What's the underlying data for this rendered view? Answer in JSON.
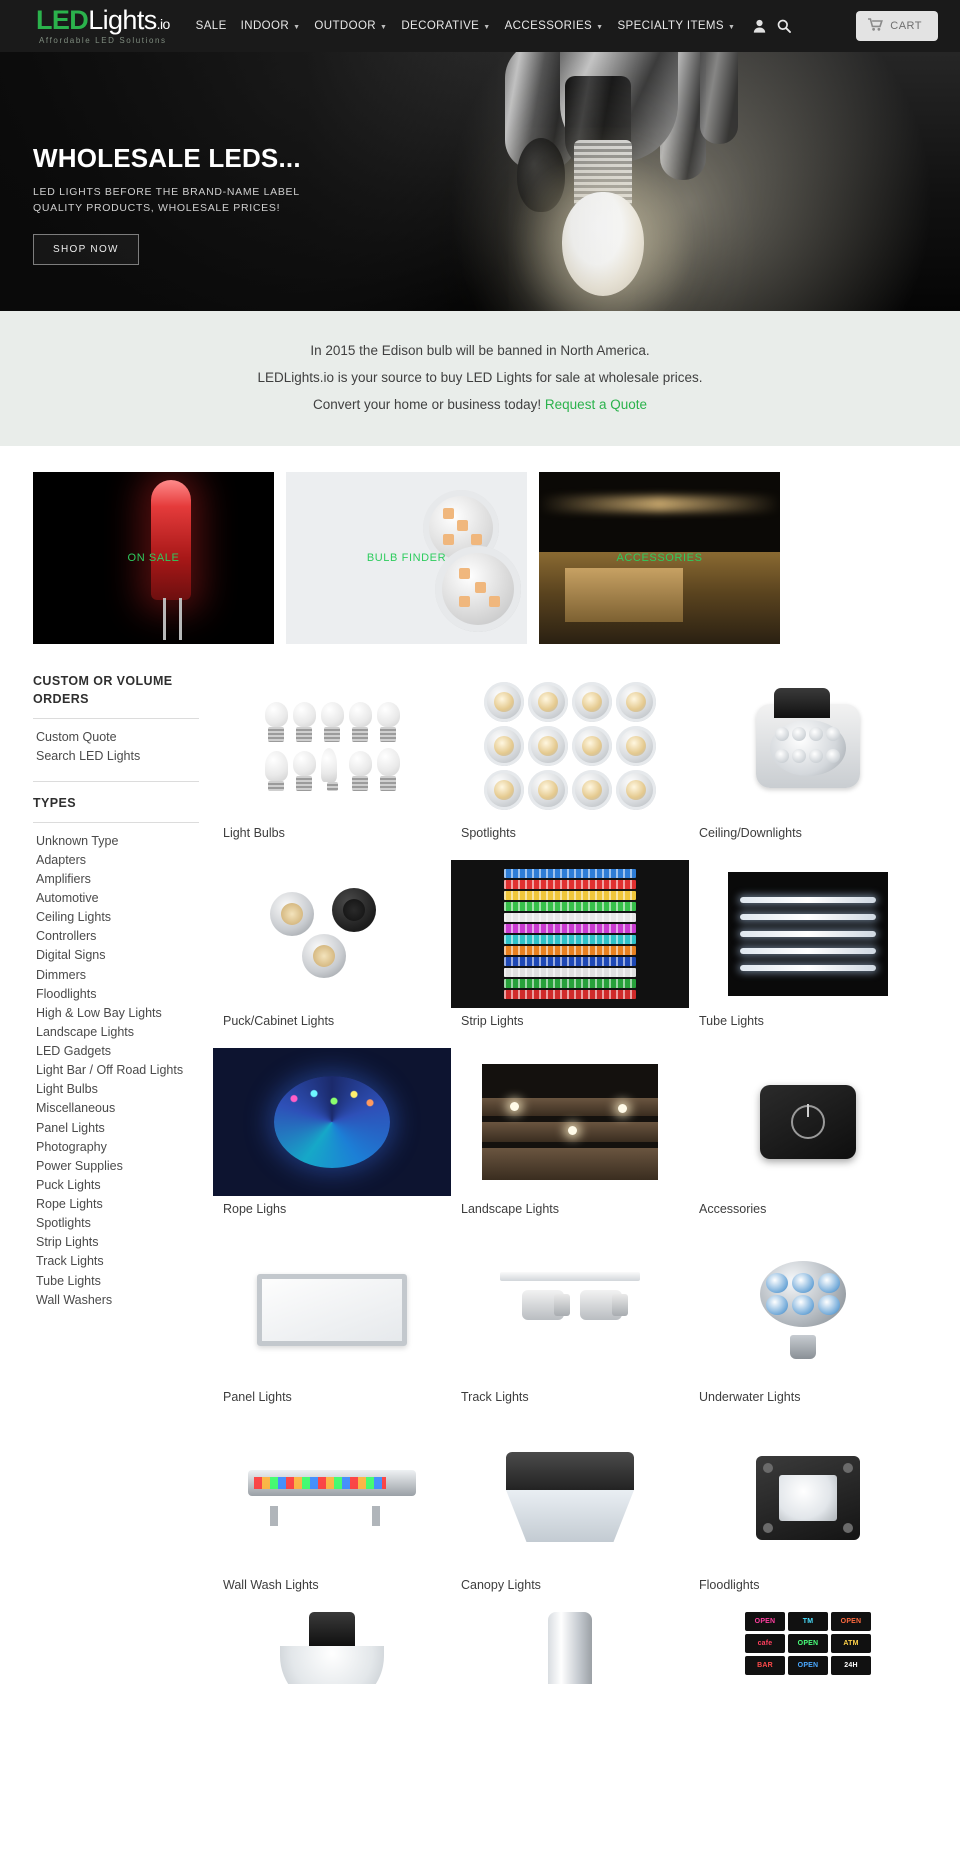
{
  "header": {
    "logo": {
      "led": "LED",
      "lights": "Lights",
      "io": ".io",
      "tagline": "Affordable LED Solutions"
    },
    "nav": [
      {
        "label": "SALE",
        "has_caret": false
      },
      {
        "label": "INDOOR",
        "has_caret": true
      },
      {
        "label": "OUTDOOR",
        "has_caret": true
      },
      {
        "label": "DECORATIVE",
        "has_caret": true
      },
      {
        "label": "ACCESSORIES",
        "has_caret": true
      },
      {
        "label": "SPECIALTY ITEMS",
        "has_caret": true
      }
    ],
    "account_icon": "user-icon",
    "search_icon": "search-icon",
    "cart_label": "CART",
    "cart_icon": "cart-icon"
  },
  "hero": {
    "title": "WHOLESALE LEDS...",
    "subtitle_line1": "LED LIGHTS BEFORE THE BRAND-NAME LABEL",
    "subtitle_line2": "QUALITY PRODUCTS, WHOLESALE PRICES!",
    "button_label": "SHOP NOW"
  },
  "infobar": {
    "line1": "In 2015 the Edison bulb will be banned in North America.",
    "line2": "LEDLights.io is your source to buy LED Lights for sale at wholesale prices.",
    "line3_text": "Convert your home or business today!",
    "line3_link": "Request a Quote"
  },
  "promos": [
    {
      "label": "ON SALE"
    },
    {
      "label": "BULB FINDER"
    },
    {
      "label": "ACCESSORIES"
    }
  ],
  "sidebar": {
    "custom_heading": "CUSTOM OR VOLUME ORDERS",
    "custom_links": [
      {
        "label": "Custom Quote"
      },
      {
        "label": "Search LED Lights"
      }
    ],
    "types_heading": "TYPES",
    "types": [
      {
        "label": "Unknown Type"
      },
      {
        "label": "Adapters"
      },
      {
        "label": "Amplifiers"
      },
      {
        "label": "Automotive"
      },
      {
        "label": "Ceiling Lights"
      },
      {
        "label": "Controllers"
      },
      {
        "label": "Digital Signs"
      },
      {
        "label": "Dimmers"
      },
      {
        "label": "Floodlights"
      },
      {
        "label": "High & Low Bay Lights"
      },
      {
        "label": "Landscape Lights"
      },
      {
        "label": "LED Gadgets"
      },
      {
        "label": "Light Bar / Off Road Lights"
      },
      {
        "label": "Light Bulbs"
      },
      {
        "label": "Miscellaneous"
      },
      {
        "label": "Panel Lights"
      },
      {
        "label": "Photography"
      },
      {
        "label": "Power Supplies"
      },
      {
        "label": "Puck Lights"
      },
      {
        "label": "Rope Lights"
      },
      {
        "label": "Spotlights"
      },
      {
        "label": "Strip Lights"
      },
      {
        "label": "Track Lights"
      },
      {
        "label": "Tube Lights"
      },
      {
        "label": "Wall Washers"
      }
    ]
  },
  "products": [
    {
      "label": "Light Bulbs"
    },
    {
      "label": "Spotlights"
    },
    {
      "label": "Ceiling/Downlights"
    },
    {
      "label": "Puck/Cabinet Lights"
    },
    {
      "label": "Strip Lights"
    },
    {
      "label": "Tube Lights"
    },
    {
      "label": "Rope Lighs"
    },
    {
      "label": "Landscape Lights"
    },
    {
      "label": "Accessories"
    },
    {
      "label": "Panel Lights"
    },
    {
      "label": "Track Lights"
    },
    {
      "label": "Underwater Lights"
    },
    {
      "label": "Wall Wash Lights"
    },
    {
      "label": "Canopy Lights"
    },
    {
      "label": "Floodlights"
    },
    {
      "label": ""
    },
    {
      "label": ""
    },
    {
      "label": ""
    }
  ],
  "signs": [
    {
      "text": "OPEN",
      "color": "#ff3fa0"
    },
    {
      "text": "TM",
      "color": "#49e0ff"
    },
    {
      "text": "OPEN",
      "color": "#ff6a3f"
    },
    {
      "text": "cafe",
      "color": "#ff3f5e"
    },
    {
      "text": "OPEN",
      "color": "#49ff7a"
    },
    {
      "text": "ATM",
      "color": "#ffd24a"
    },
    {
      "text": "BAR",
      "color": "#ff4a4a"
    },
    {
      "text": "OPEN",
      "color": "#4aa8ff"
    },
    {
      "text": "24H",
      "color": "#ffffff"
    }
  ],
  "colors": {
    "brand_green": "#2bb24c",
    "header_bg": "#1a1a1a",
    "infobar_bg": "#e9edea",
    "text": "#3d3d3d"
  }
}
